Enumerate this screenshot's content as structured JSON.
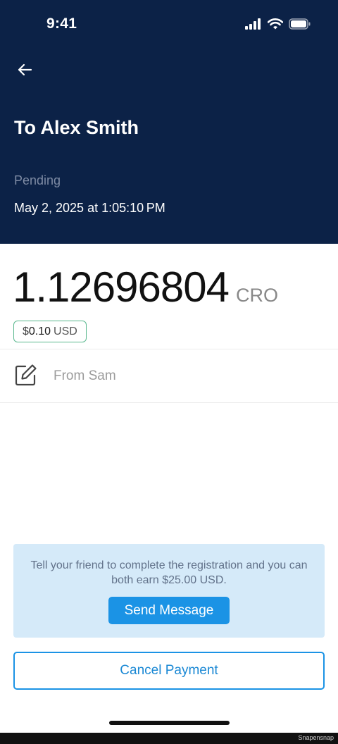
{
  "status_bar": {
    "time": "9:41"
  },
  "header": {
    "back_icon": "arrow-left-icon",
    "title": "To Alex Smith",
    "status": "Pending",
    "datetime": "May 2, 2025 at 1:05:10 PM"
  },
  "amount": {
    "value": "1.12696804",
    "unit": "CRO",
    "fiat_symbol": "$",
    "fiat_value": "0.10",
    "fiat_code": "USD"
  },
  "note": {
    "icon": "edit-note-icon",
    "text": "From Sam"
  },
  "referral": {
    "message": "Tell your friend to complete the registration and you can both earn $25.00 USD.",
    "button_label": "Send Message"
  },
  "cancel_label": "Cancel Payment",
  "watermark": "Snapensnap",
  "colors": {
    "header_bg": "#0c2247",
    "accent": "#1b93e5",
    "badge_border": "#5ab88e",
    "referral_bg": "#d5eaf9"
  }
}
